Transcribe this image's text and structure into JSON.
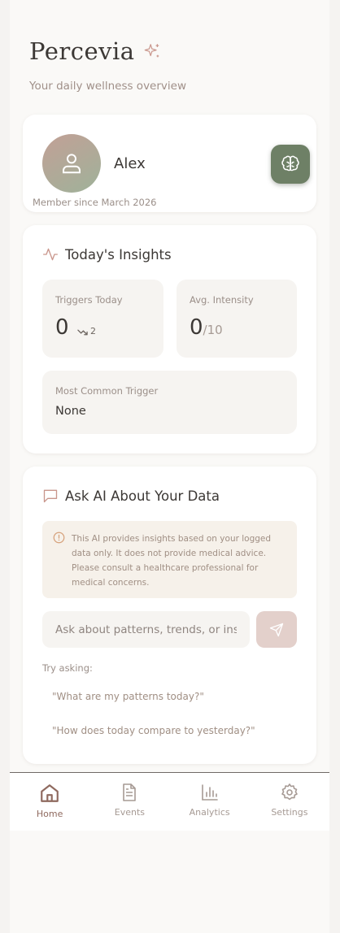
{
  "app": {
    "title": "Percevia",
    "subtitle": "Your daily wellness overview"
  },
  "profile": {
    "name": "Alex",
    "member_since": "Member since March 2026"
  },
  "insights": {
    "heading": "Today's Insights",
    "triggers": {
      "label": "Triggers Today",
      "value": "0",
      "trend": "2"
    },
    "intensity": {
      "label": "Avg. Intensity",
      "value": "0",
      "suffix": "/10"
    },
    "common": {
      "label": "Most Common Trigger",
      "value": "None"
    }
  },
  "ai": {
    "heading": "Ask AI About Your Data",
    "disclaimer": "This AI provides insights based on your logged data only. It does not provide medical advice. Please consult a healthcare professional for medical concerns.",
    "input_placeholder": "Ask about patterns, trends, or insights...",
    "input_value": "",
    "try_label": "Try asking:",
    "suggestions": [
      "\"What are my patterns today?\"",
      "\"How does today compare to yesterday?\""
    ]
  },
  "nav": [
    {
      "label": "Home",
      "icon": "home-icon",
      "active": true
    },
    {
      "label": "Events",
      "icon": "document-icon",
      "active": false
    },
    {
      "label": "Analytics",
      "icon": "bar-chart-icon",
      "active": false
    },
    {
      "label": "Settings",
      "icon": "gear-icon",
      "active": false
    }
  ],
  "colors": {
    "accent": "#6e8066",
    "active_nav": "#8f6a5f",
    "send_button": "#e3d0cb",
    "disclaimer_bg": "#f6f1ea"
  }
}
